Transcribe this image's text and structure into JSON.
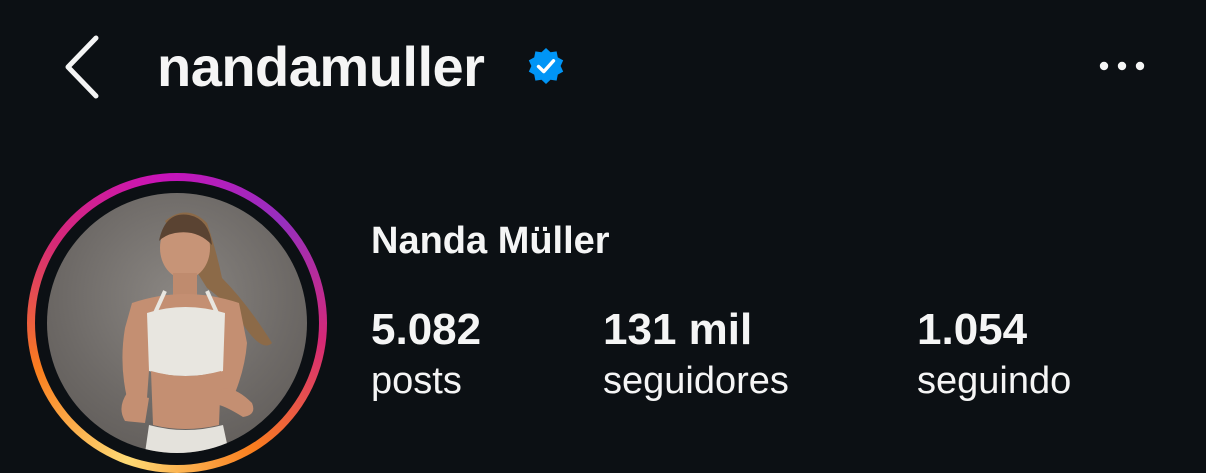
{
  "header": {
    "username": "nandamuller",
    "back_icon": "chevron-left-icon",
    "verified_icon": "verified-badge-icon",
    "more_icon": "more-horizontal-icon"
  },
  "profile": {
    "display_name": "Nanda Müller",
    "avatar_has_story_ring": true
  },
  "stats": {
    "posts": {
      "value": "5.082",
      "label": "posts"
    },
    "followers": {
      "value": "131 mil",
      "label": "seguidores"
    },
    "following": {
      "value": "1.054",
      "label": "seguindo"
    }
  },
  "colors": {
    "background": "#0c1014",
    "text": "#f5f5f5",
    "verified": "#0095f6",
    "story_ring_start": "#feda75",
    "story_ring_mid": "#d62976",
    "story_ring_end": "#962fbf"
  }
}
